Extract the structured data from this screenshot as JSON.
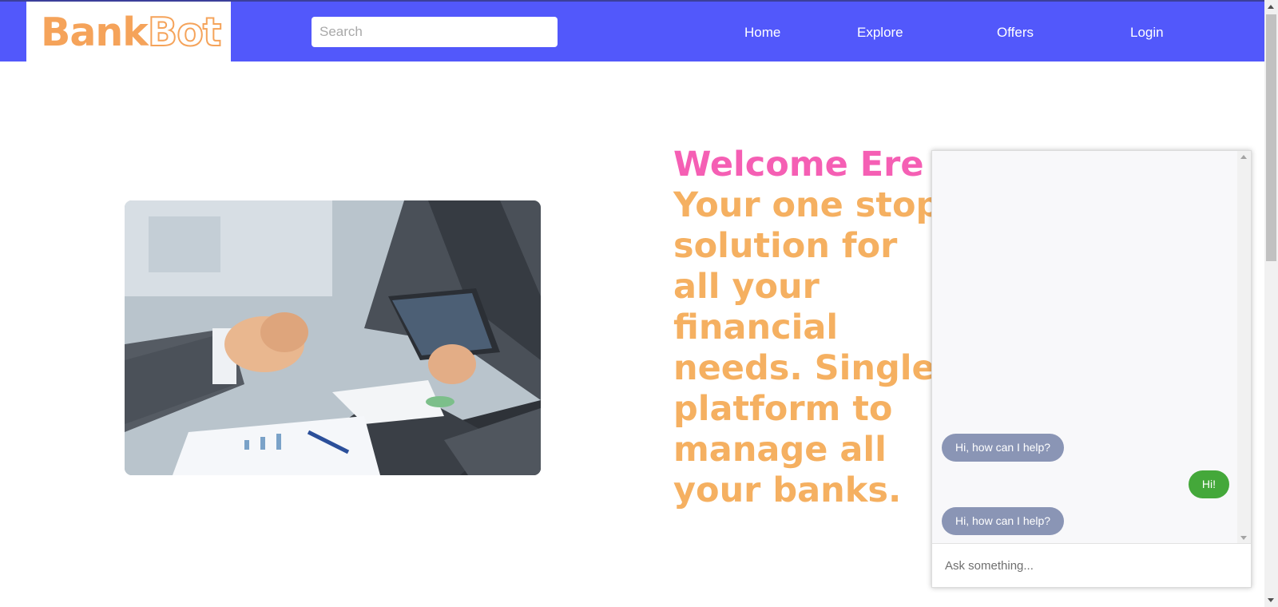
{
  "brand": {
    "logo_part1": "Bank",
    "logo_part2": "Bot"
  },
  "search": {
    "placeholder": "Search"
  },
  "nav": {
    "home": "Home",
    "explore": "Explore",
    "offers": "Offers",
    "login": "Login"
  },
  "hero": {
    "image_alt": "business-handshake-image",
    "welcome": "Welcome Ere",
    "tagline": "Your one stop solution for all your financial needs. Single platform to manage all your banks."
  },
  "chat": {
    "messages": [
      {
        "from": "bot",
        "text": "Hi, how can I help?"
      },
      {
        "from": "user",
        "text": "Hi!"
      },
      {
        "from": "bot",
        "text": "Hi, how can I help?"
      }
    ],
    "input_placeholder": "Ask something..."
  },
  "colors": {
    "navbar": "#5258fb",
    "logo": "#f5a35a",
    "welcome": "#f55fb4",
    "tagline": "#f5b061",
    "bot_bubble": "#8a95b5",
    "user_bubble": "#44a83a"
  }
}
